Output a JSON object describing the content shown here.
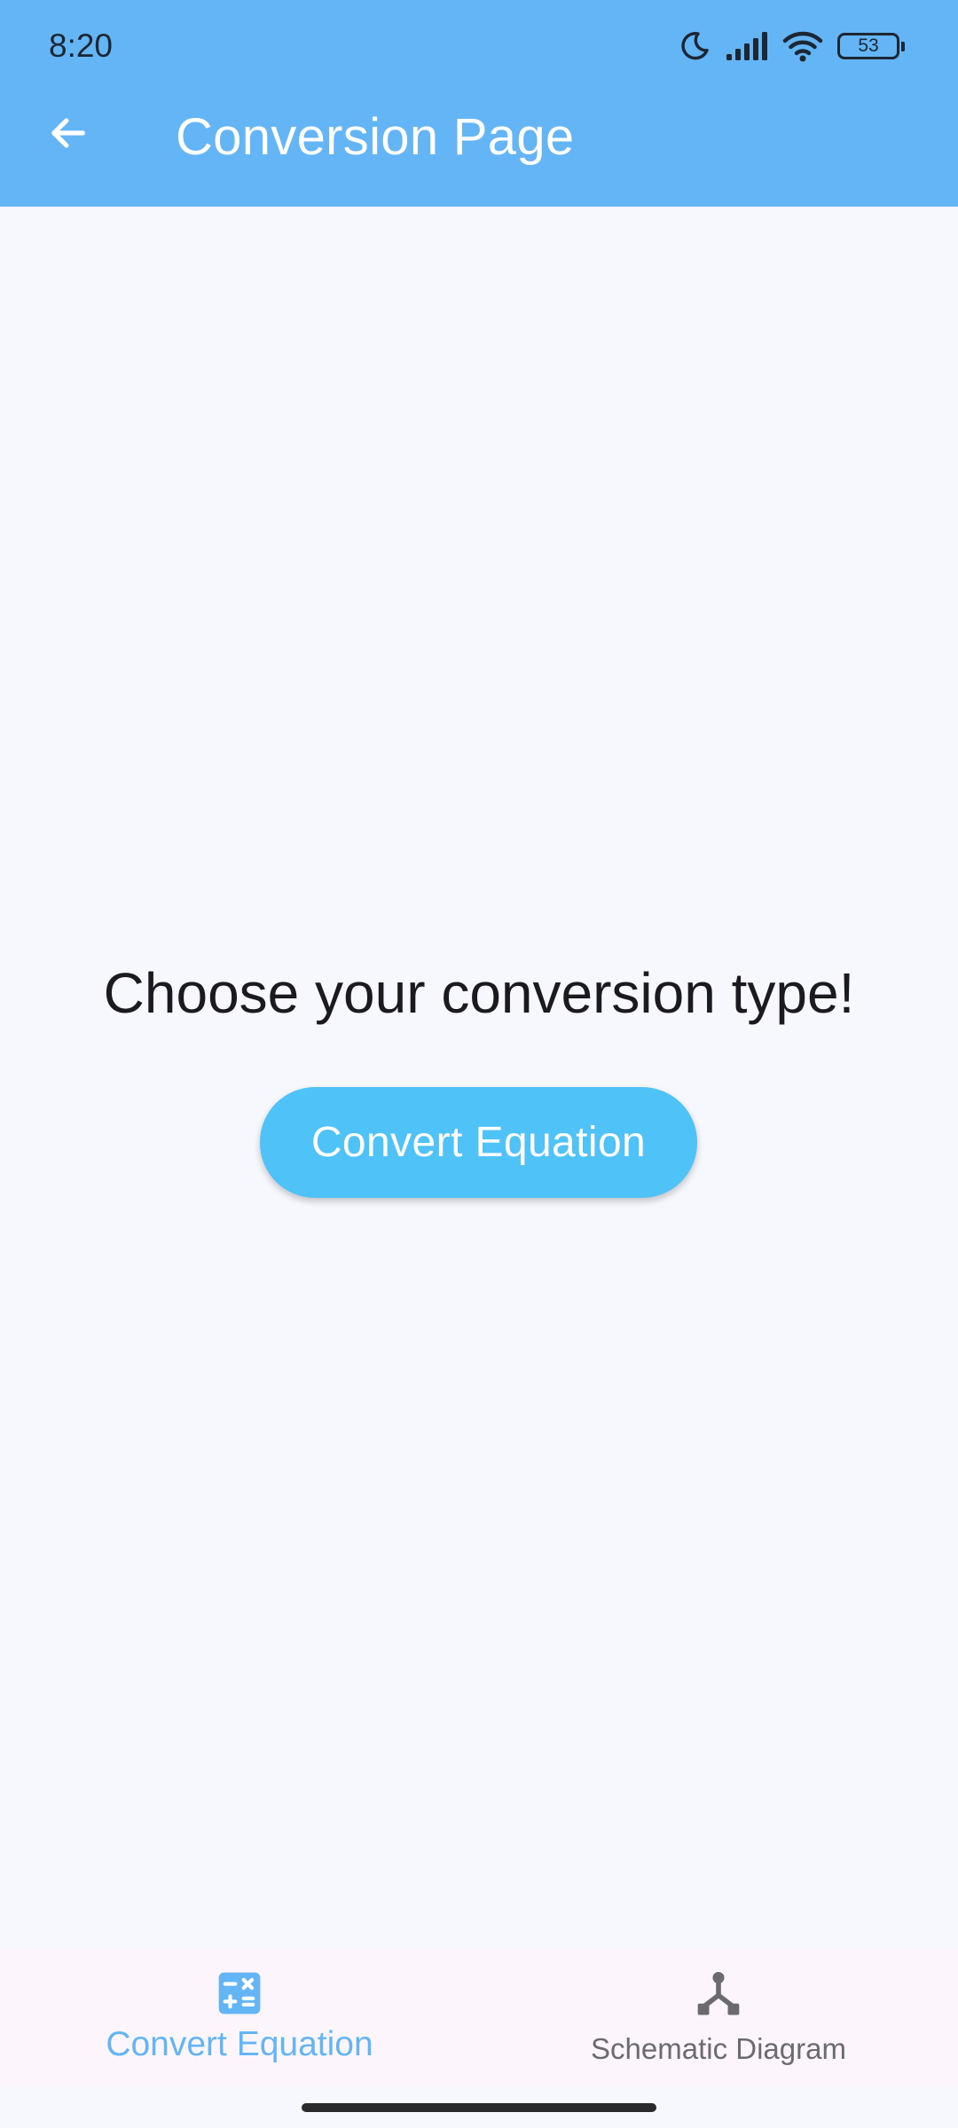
{
  "status_bar": {
    "time": "8:20",
    "battery": "53",
    "icons": [
      "moon-icon",
      "signal-icon",
      "wifi-icon",
      "battery-icon"
    ]
  },
  "app_bar": {
    "title": "Conversion Page",
    "back_icon": "arrow-back-icon",
    "color": "#64B5F6"
  },
  "main": {
    "prompt": "Choose your conversion type!",
    "convert_button_label": "Convert Equation",
    "button_color": "#4FC3F7"
  },
  "bottom_nav": {
    "items": [
      {
        "label": "Convert Equation",
        "icon": "calculator-icon",
        "active": true
      },
      {
        "label": "Schematic Diagram",
        "icon": "schema-icon",
        "active": false
      }
    ],
    "active_color": "#64B5F6",
    "inactive_color": "#6B6B6F"
  }
}
